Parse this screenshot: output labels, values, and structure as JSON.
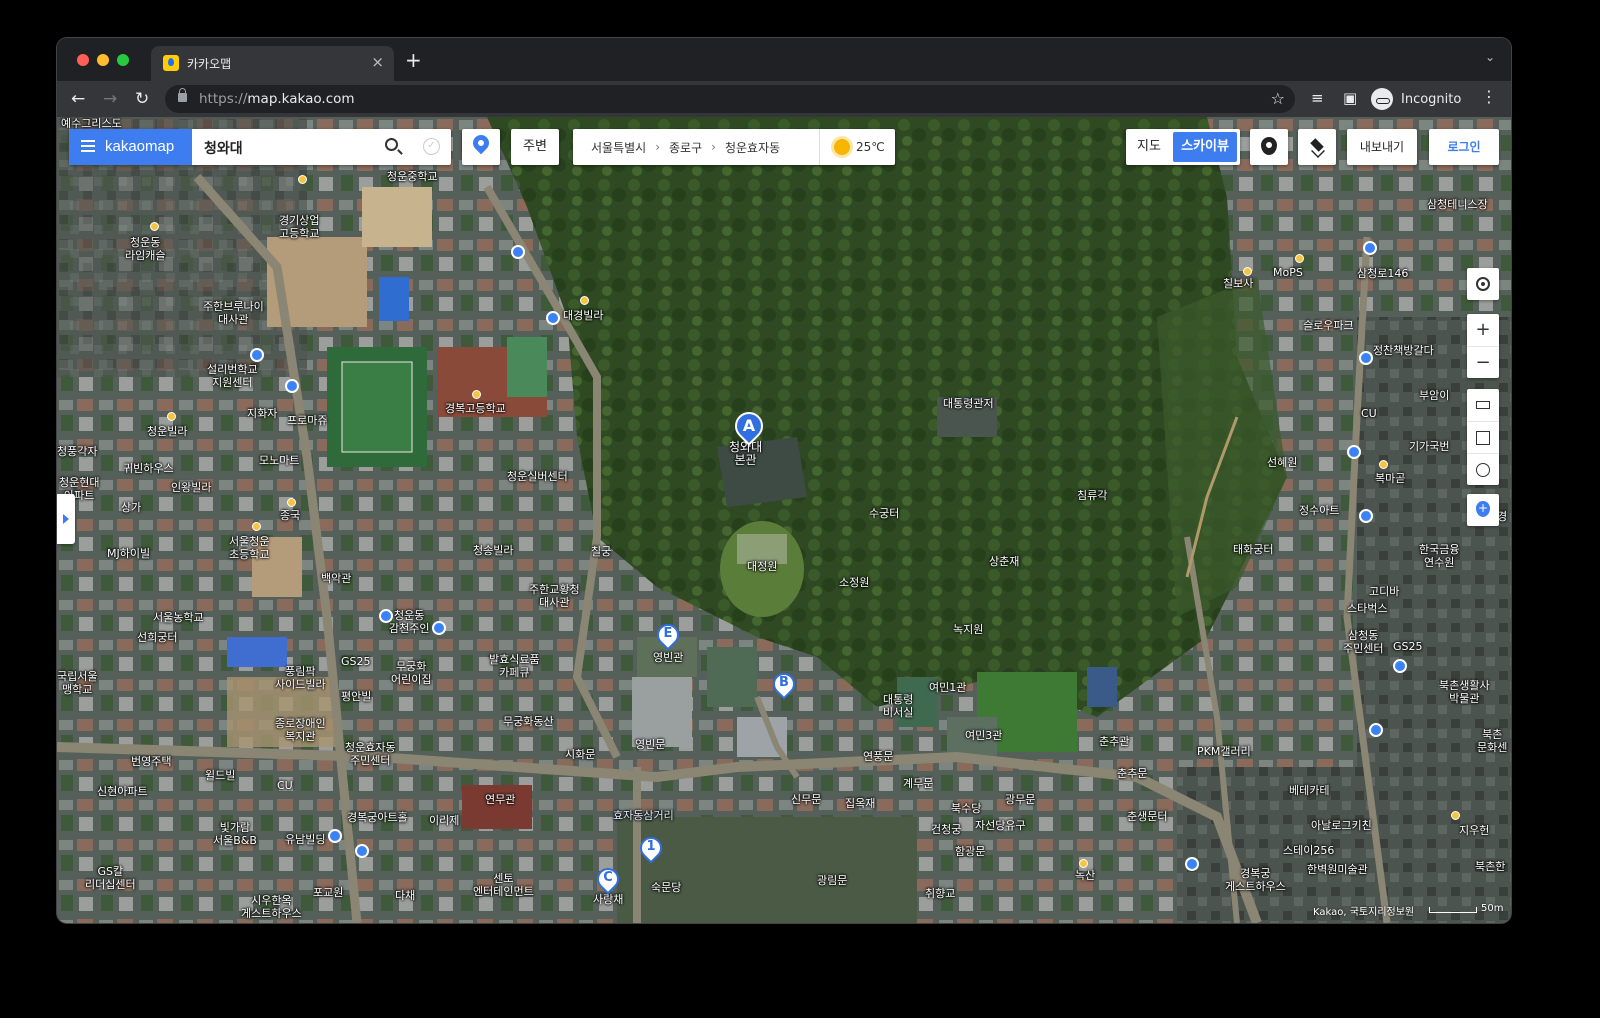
{
  "browser": {
    "tab_title": "카카오맵",
    "tab_close": "×",
    "new_tab": "+",
    "url_protocol": "https://",
    "url_host": "map.kakao.com",
    "profile_label": "Incognito"
  },
  "toolbar": {
    "brand": "kakaomap",
    "query": "청와대",
    "nearby_label": "주변",
    "breadcrumb": [
      "서울특별시",
      "종로구",
      "청운효자동"
    ],
    "temperature": "25℃",
    "maptype_map": "지도",
    "maptype_skyview": "스카이뷰",
    "export_label": "내보내기",
    "login_label": "로그인"
  },
  "controls": {
    "zoom_in": "+",
    "zoom_out": "−"
  },
  "markers": {
    "a": "A",
    "b": "B",
    "c": "C",
    "e": "E",
    "one": "1"
  },
  "map_labels": {
    "l01": "예수그리스도",
    "l02": "청운중학교",
    "l03": "경기상업\n고등학교",
    "l04": "청운동\n라임캐슬",
    "l05": "주한브루나이\n대사관",
    "l06": "대경빌라",
    "l07": "설리번학교\n지원센터",
    "l08": "지화자",
    "l09": "프로마쥬",
    "l10": "경복고등학교",
    "l11": "청운빌라",
    "l12": "청풍각자",
    "l13": "모노마트",
    "l14": "귀빈하우스",
    "l15": "인왕빌라",
    "l16": "청운현대\n아파트",
    "l17": "상가",
    "l18": "종국",
    "l19": "청운실버센터",
    "l20": "MJ하이빌",
    "l21": "서울청운\n초등학교",
    "l22": "청송빌라",
    "l23": "칠궁",
    "l24": "백악관",
    "l25": "주한교황청\n대사관",
    "l26": "서울농학교",
    "l27": "청운동\n감천주인",
    "l28": "선희궁터",
    "l29": "GS25",
    "l30": "풍림팍\n사이드빌라",
    "l31": "무궁화\n어린이집",
    "l32": "발효식료품\n카페큐",
    "l33": "국립서울\n맹학교",
    "l34": "평안빌",
    "l35": "무궁화동산",
    "l36": "종로장애인\n복지관",
    "l37": "청운효자동\n주민센터",
    "l38": "번영주택",
    "l39": "윌드빌",
    "l40": "CU",
    "l41": "신현아파트",
    "l42": "연무관",
    "l43": "경복궁아트홀",
    "l44": "이리제",
    "l45": "빛가람\n서울B&B",
    "l46": "유남빌딩",
    "l47": "GS칼\n리더십센터",
    "l48": "포교원",
    "l49": "시우한옥\n게스트하우스",
    "l50": "다채",
    "l51": "센토\n엔터테인먼트",
    "l52": "사랑채",
    "l53": "숙문당",
    "l54": "효자동삼거리",
    "l55": "청와대\n본관",
    "l56": "대통령관저",
    "l57": "침류각",
    "l58": "수궁터",
    "l59": "대정원",
    "l60": "소정원",
    "l61": "상춘재",
    "l62": "녹지원",
    "l63": "영빈관",
    "l64": "영빈문",
    "l65": "시화문",
    "l66": "대통령\n비서실",
    "l67": "여민1관",
    "l68": "여민3관",
    "l69": "연풍문",
    "l70": "계무문",
    "l71": "신무문",
    "l72": "집옥재",
    "l73": "북수당",
    "l74": "광무문",
    "l75": "건청궁",
    "l76": "자선당유구",
    "l77": "함광문",
    "l78": "광림문",
    "l79": "취향교",
    "l80": "녹산",
    "l81": "춘추관",
    "l82": "춘추문",
    "l83": "춘생문터",
    "l84": "PKM갤러리",
    "l85": "베테카테",
    "l86": "아날로그키친",
    "l87": "스테이256",
    "l88": "한벽원미술관",
    "l89": "경복궁\n게스트하우스",
    "l90": "삼청테니스장",
    "l91": "MoPS",
    "l92": "삼청로146",
    "l93": "칠보사",
    "l94": "슬로우파크",
    "l95": "정찬책방갈다",
    "l96": "부암이",
    "l97": "CU",
    "l98": "기가국번",
    "l99": "선혜원",
    "l100": "복마곧",
    "l101": "정수아트",
    "l102": "태화궁터",
    "l103": "한국금융\n연수원",
    "l104": "고디바",
    "l105": "스타벅스",
    "l106": "삼청동\n주민센터",
    "l107": "GS25",
    "l108": "북촌생활사\n박물관",
    "l109": "북촌\n문화센",
    "l110": "지우헌",
    "l111": "북촌한",
    "l112": "경"
  },
  "footer": {
    "copyright": "Kakao, 국토지리정보원",
    "scale": "50m"
  },
  "colors": {
    "brand_blue": "#3d7df0",
    "chrome_dark": "#202124",
    "marker_blue": "#2f6fe0"
  }
}
